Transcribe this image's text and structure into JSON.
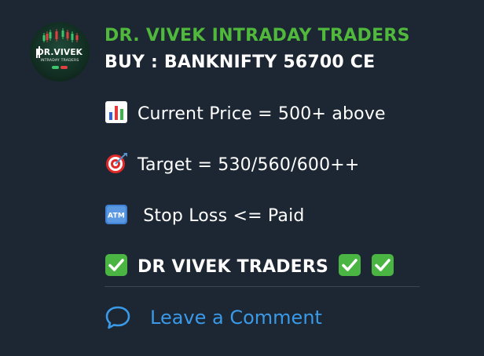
{
  "avatar": {
    "title": "DR.VIVEK",
    "subtitle": "INTRADAY TRADERS",
    "icon": "candlestick-chart-logo"
  },
  "message": {
    "sender": "DR. VIVEK INTRADAY TRADERS",
    "headline": "BUY : BANKNIFTY 56700 CE",
    "lines": [
      {
        "icon": "bar-chart-emoji",
        "text": "Current Price = 500+ above"
      },
      {
        "icon": "direct-hit-target-emoji",
        "text": "Target = 530/560/600++"
      },
      {
        "icon": "atm-sign-emoji",
        "text": " Stop Loss <=  Paid"
      },
      {
        "icon": "check-mark-button-emoji",
        "text": "DR VIVEK TRADERS"
      }
    ],
    "trailing_icons": [
      "check-mark-button-emoji",
      "check-mark-button-emoji"
    ]
  },
  "footer": {
    "comment_label": "Leave a Comment",
    "icon": "speech-bubble-icon"
  },
  "colors": {
    "background": "#1c2733",
    "sender": "#50b93c",
    "text": "#ffffff",
    "link": "#3a9ae8",
    "divider": "#3a4754"
  }
}
